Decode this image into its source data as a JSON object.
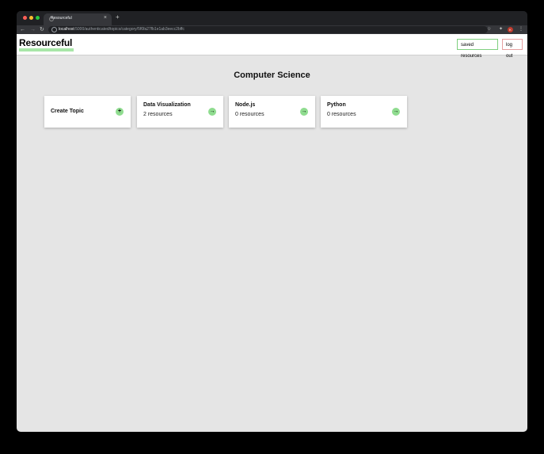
{
  "browser": {
    "tab_title": "Resourceful",
    "tab_close": "×",
    "new_tab": "+",
    "url_host": "localhost",
    "url_path": ":5000/authenticated/topics/category/5f6fa27fb1e1ab3eecc2bffc",
    "profile_initial": "K",
    "icons": [
      "back-arrow-icon",
      "forward-arrow-icon",
      "reload-icon",
      "info-icon",
      "star-icon",
      "extensions-icon",
      "kebab-menu-icon"
    ]
  },
  "header": {
    "brand": "Resourceful",
    "saved_resources": "saved resources",
    "log_out": "log out"
  },
  "main": {
    "category_title": "Computer Science",
    "create_topic": "Create Topic",
    "topics": [
      {
        "title": "Data Visualization",
        "count": "2 resources"
      },
      {
        "title": "Node.js",
        "count": "0 resources"
      },
      {
        "title": "Python",
        "count": "0 resources"
      }
    ]
  },
  "colors": {
    "accent_green": "#8fdc8f",
    "brand_underline": "#a8e6a8",
    "logout_border": "#e6a0a0",
    "page_bg": "#e5e5e5"
  }
}
